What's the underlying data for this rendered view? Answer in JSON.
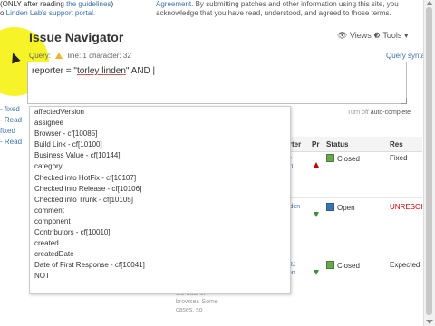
{
  "top_left": {
    "line1_prefix": "(ONLY after reading ",
    "line1_link": "the guidelines",
    "line1_suffix": ")",
    "line2_prefix": "o ",
    "line2_link": "Linden Lab's support portal."
  },
  "top_right": {
    "line1_link": "Agreement",
    "line1_text": ". By submitting patches and other information using this site, you",
    "line2_text": "acknowledge that you have read, understood, and agreed to those terms."
  },
  "header": {
    "title": "Issue Navigator",
    "views_label": "Views",
    "tools_label": "Tools"
  },
  "query": {
    "label": "Query:",
    "line_text": "line: 1",
    "character_text": "character: 32",
    "syntax_help": "Query syntax",
    "value_prefix": "reporter = \"",
    "value_underlined": "torley linden",
    "value_suffix": "\" AND |",
    "autocomplete_prefix": "Turn off",
    "autocomplete_label": "auto-complete"
  },
  "side_links": [
    "- fixed",
    "- Read",
    "fixed",
    "- Read"
  ],
  "suggestions": [
    "affectedVersion",
    "assignee",
    "Browser - cf[10085]",
    "Build Link - cf[10100]",
    "Business Value - cf[10144]",
    "category",
    "Checked into HotFix - cf[10107]",
    "Checked into Release - cf[10106]",
    "Checked into Trunk - cf[10105]",
    "comment",
    "component",
    "Contributors - cf[10010]",
    "created",
    "createdDate",
    "Date of First Response - cf[10041]",
    "NOT"
  ],
  "table": {
    "headers": {
      "reporter": "orter",
      "priority": "Pr",
      "status": "Status",
      "resolution": "Res"
    },
    "rows": [
      {
        "reporter_frag": "no\ndin",
        "status": "Closed",
        "resolution": "Fixed",
        "priority": "up"
      },
      {
        "reporter_frag": "inden",
        "status": "Open",
        "resolution": "UNRESOI",
        "priority": "down"
      },
      {
        "reporter_frag": "nRJ\nden",
        "status": "Closed",
        "resolution": "Expected",
        "priority": "down"
      }
    ],
    "bottom_fragment": "the dual of\nbrowser. Some\ncases, so"
  },
  "colors": {
    "link": "#3b73af",
    "highlight": "#f7f21e",
    "unresolved": "#cc0000"
  }
}
